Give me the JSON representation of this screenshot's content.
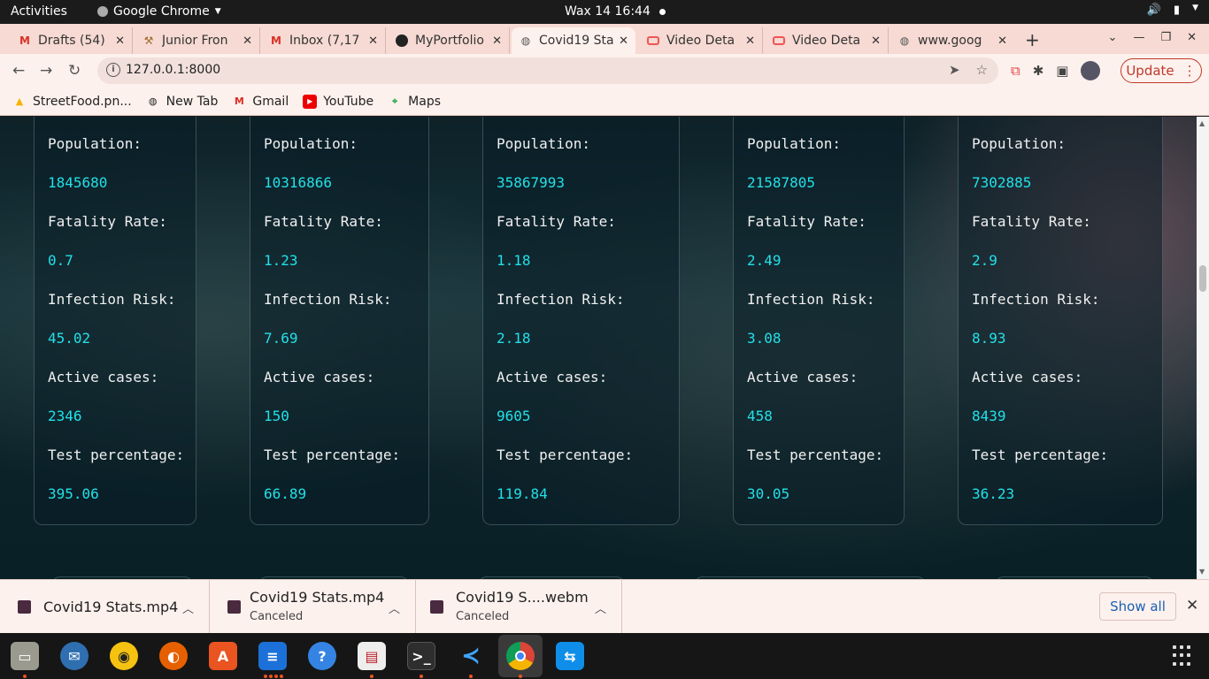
{
  "topbar": {
    "activities": "Activities",
    "app_name": "Google Chrome",
    "clock": "Wax 14  16:44"
  },
  "tabs": [
    {
      "title": "Drafts (54)",
      "icon": "gmail-icon"
    },
    {
      "title": "Junior Fron",
      "icon": "hammer-icon"
    },
    {
      "title": "Inbox (7,17",
      "icon": "gmail-icon"
    },
    {
      "title": "MyPortfolio",
      "icon": "github-icon"
    },
    {
      "title": "Covid19 Sta",
      "icon": "globe-icon"
    },
    {
      "title": "Video Deta",
      "icon": "video-icon"
    },
    {
      "title": "Video Deta",
      "icon": "video-icon"
    },
    {
      "title": "www.goog",
      "icon": "globe-icon"
    }
  ],
  "address_bar": {
    "url": "127.0.0.1:8000",
    "update_label": "Update"
  },
  "bookmarks": [
    {
      "label": "StreetFood.pn...",
      "icon": "drive-icon"
    },
    {
      "label": "New Tab",
      "icon": "globe-icon"
    },
    {
      "label": "Gmail",
      "icon": "gmail-icon"
    },
    {
      "label": "YouTube",
      "icon": "youtube-icon"
    },
    {
      "label": "Maps",
      "icon": "maps-icon"
    }
  ],
  "labels": {
    "population": "Population:",
    "fatality": "Fatality Rate:",
    "infection": "Infection Risk:",
    "active": "Active cases:",
    "test": "Test percentage:"
  },
  "cards": [
    {
      "population": "1845680",
      "fatality": "0.7",
      "infection": "45.02",
      "active": "2346",
      "test": "395.06"
    },
    {
      "population": "10316866",
      "fatality": "1.23",
      "infection": "7.69",
      "active": "150",
      "test": "66.89"
    },
    {
      "population": "35867993",
      "fatality": "1.18",
      "infection": "2.18",
      "active": "9605",
      "test": "119.84"
    },
    {
      "population": "21587805",
      "fatality": "2.49",
      "infection": "3.08",
      "active": "458",
      "test": "30.05"
    },
    {
      "population": "7302885",
      "fatality": "2.9",
      "infection": "8.93",
      "active": "8439",
      "test": "36.23"
    }
  ],
  "downloads": [
    {
      "name": "Covid19 Stats.mp4",
      "status": ""
    },
    {
      "name": "Covid19 Stats.mp4",
      "status": "Canceled"
    },
    {
      "name": "Covid19 S....webm",
      "status": "Canceled"
    }
  ],
  "shelf": {
    "show_all": "Show all"
  },
  "colors": {
    "accent_value": "#22e0e8",
    "update_red": "#c0392b",
    "ubuntu_orange": "#e95420"
  }
}
